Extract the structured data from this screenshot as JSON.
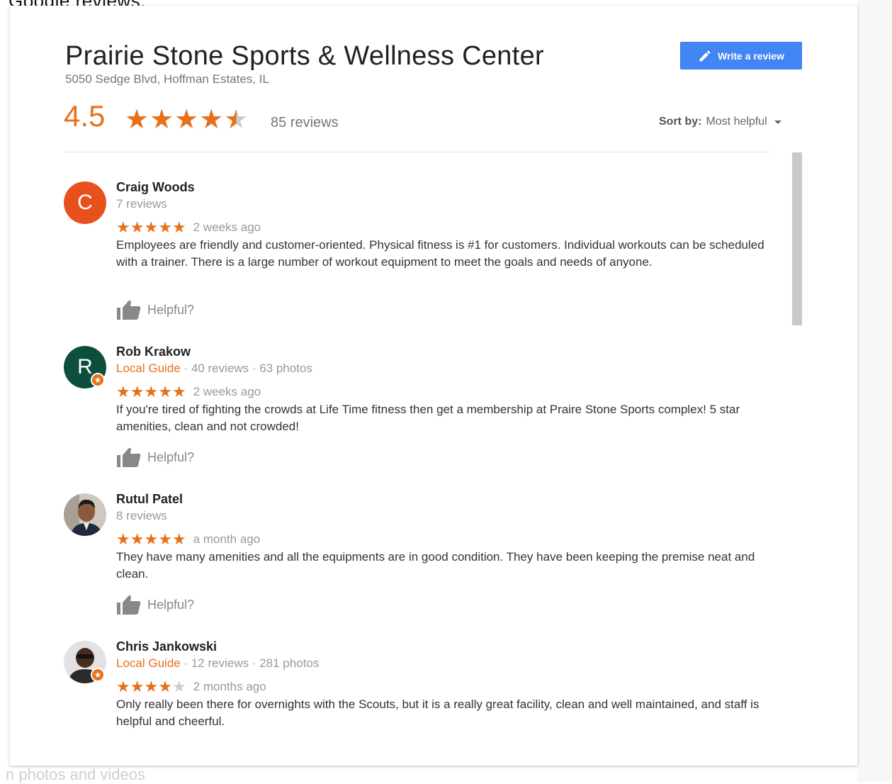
{
  "caption_top": "Google reviews:",
  "caption_bottom": "n photos and videos",
  "place": {
    "name": "Prairie Stone Sports & Wellness Center",
    "address": "5050 Sedge Blvd, Hoffman Estates, IL",
    "rating": "4.5",
    "rating_value": 4.5,
    "reviews_count": "85 reviews"
  },
  "write_review": {
    "label": "Write a review"
  },
  "sort": {
    "label": "Sort by:",
    "value": "Most helpful"
  },
  "reviews": [
    {
      "name": "Craig Woods",
      "avatar_letter": "C",
      "avatar_color": "#e8501e",
      "local_guide": "",
      "meta": "7 reviews",
      "stars": 5,
      "date": "2 weeks ago",
      "text": "Employees are friendly and customer-oriented. Physical fitness is #1 for customers. Individual workouts can be scheduled with  a trainer. There is a large number of workout equipment to meet the goals and needs of anyone.",
      "helpful": "Helpful?"
    },
    {
      "name": "Rob Krakow",
      "avatar_letter": "R",
      "avatar_color": "#0d4f3c",
      "local_guide": "Local Guide",
      "meta": " · 40 reviews · 63 photos",
      "stars": 5,
      "date": "2 weeks ago",
      "text": "If you're tired of fighting the crowds at Life Time fitness then get a membership at Praire Stone Sports complex! 5 star amenities, clean and not crowded!",
      "helpful": "Helpful?"
    },
    {
      "name": "Rutul Patel",
      "avatar_letter": "",
      "avatar_color": "#c9c2b8",
      "local_guide": "",
      "meta": "8 reviews",
      "stars": 5,
      "date": "a month ago",
      "text": "They have many amenities and all the equipments are in good condition. They have been keeping the premise neat and clean.",
      "helpful": "Helpful?"
    },
    {
      "name": "Chris Jankowski",
      "avatar_letter": "",
      "avatar_color": "#d8d8d8",
      "local_guide": "Local Guide",
      "meta": " · 12 reviews · 281 photos",
      "stars": 4,
      "date": "2 months ago",
      "text": "Only really been there for overnights with the Scouts, but it is a really great facility, clean and well maintained, and staff is helpful and cheerful.",
      "helpful": ""
    }
  ],
  "colors": {
    "accent_orange": "#e7711b",
    "button_blue": "#4285f4"
  }
}
